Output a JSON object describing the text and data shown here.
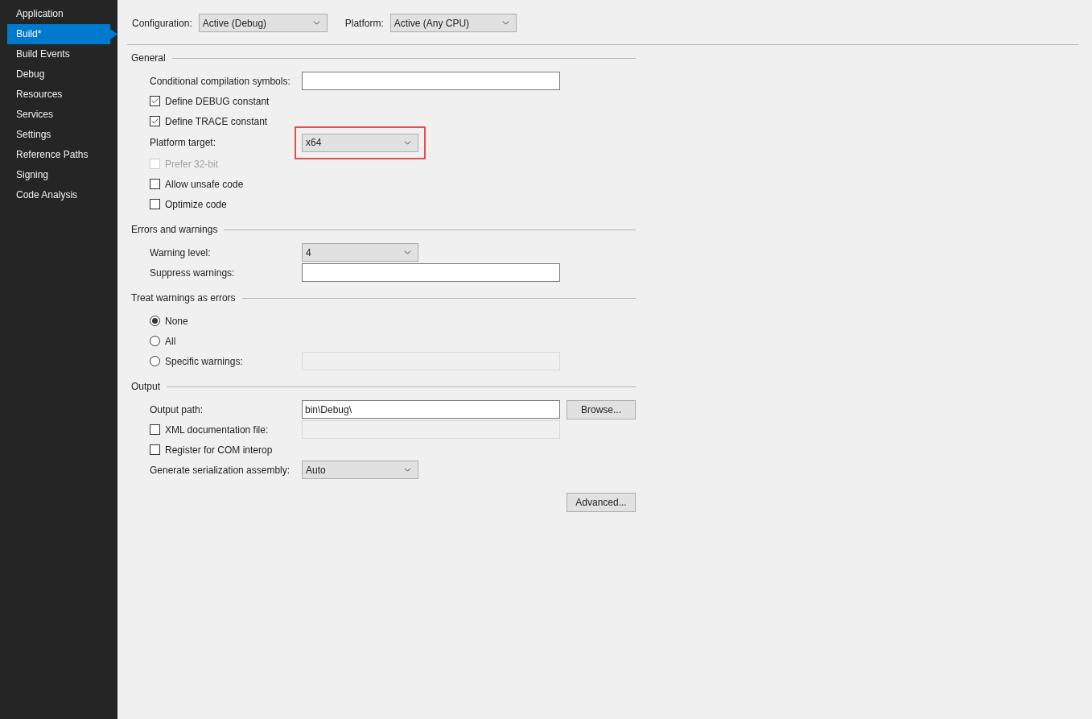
{
  "sidebar": {
    "items": [
      {
        "label": "Application",
        "selected": false
      },
      {
        "label": "Build*",
        "selected": true
      },
      {
        "label": "Build Events",
        "selected": false
      },
      {
        "label": "Debug",
        "selected": false
      },
      {
        "label": "Resources",
        "selected": false
      },
      {
        "label": "Services",
        "selected": false
      },
      {
        "label": "Settings",
        "selected": false
      },
      {
        "label": "Reference Paths",
        "selected": false
      },
      {
        "label": "Signing",
        "selected": false
      },
      {
        "label": "Code Analysis",
        "selected": false
      }
    ]
  },
  "toolbar": {
    "configuration": {
      "label": "Configuration:",
      "value": "Active (Debug)"
    },
    "platform": {
      "label": "Platform:",
      "value": "Active (Any CPU)"
    }
  },
  "sections": [
    {
      "title": "General",
      "rows": [
        {
          "kind": "field",
          "label": "Conditional compilation symbols:"
        },
        {
          "kind": "checkbox",
          "label": "Define DEBUG constant",
          "checked": true,
          "disabled": false
        },
        {
          "kind": "checkbox",
          "label": "Define TRACE constant",
          "checked": true,
          "disabled": false
        },
        {
          "kind": "dropdown",
          "label": "Platform target:",
          "value": "x64",
          "highlighted": true
        },
        {
          "kind": "checkbox",
          "label": "Prefer 32-bit",
          "checked": false,
          "disabled": true
        },
        {
          "kind": "checkbox",
          "label": "Allow unsafe code",
          "checked": false,
          "disabled": false
        },
        {
          "kind": "checkbox",
          "label": "Optimize code",
          "checked": false,
          "disabled": false
        }
      ]
    },
    {
      "title": "Errors and warnings",
      "rows": [
        {
          "kind": "dropdown",
          "label": "Warning level:",
          "value": "4",
          "highlighted": false
        },
        {
          "kind": "field",
          "label": "Suppress warnings:"
        }
      ]
    },
    {
      "title": "Treat warnings as errors",
      "rows": [
        {
          "kind": "radio",
          "label": "None",
          "selected": true
        },
        {
          "kind": "radio",
          "label": "All",
          "selected": false
        },
        {
          "kind": "radio",
          "label": "Specific warnings:",
          "selected": false,
          "field": {
            "disabled": true
          }
        }
      ]
    },
    {
      "title": "Output",
      "rows": [
        {
          "kind": "field",
          "label": "Output path:",
          "value": "bin\\Debug\\",
          "button": "Browse..."
        },
        {
          "kind": "checkbox",
          "label": "XML documentation file:",
          "checked": false,
          "disabled": false,
          "field": {
            "disabled": true
          }
        },
        {
          "kind": "checkbox",
          "label": "Register for COM interop",
          "checked": false,
          "disabled": false
        },
        {
          "kind": "dropdown",
          "label": "Generate serialization assembly:",
          "value": "Auto",
          "highlighted": false
        },
        {
          "kind": "button",
          "label": "Advanced..."
        }
      ]
    }
  ]
}
